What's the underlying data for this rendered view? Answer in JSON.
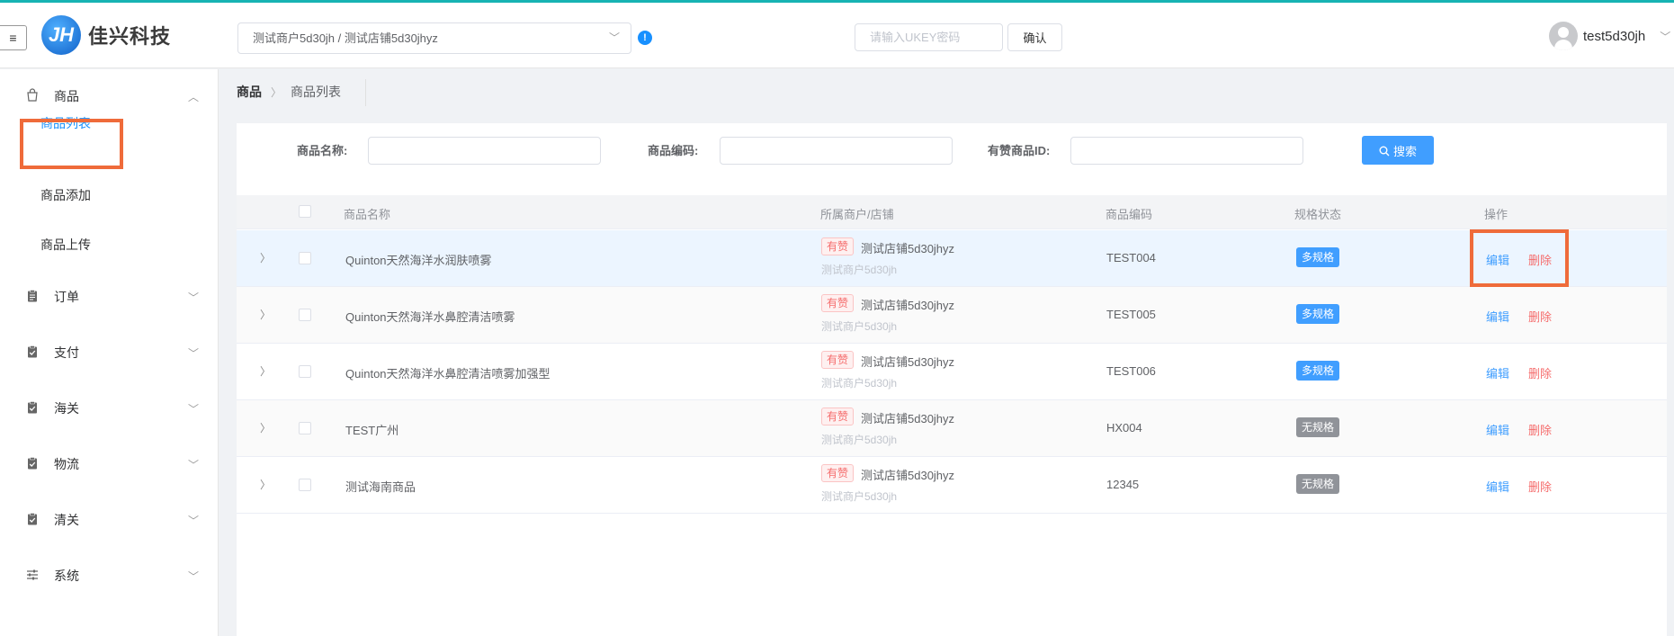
{
  "header": {
    "menu_toggle_icon": "≡",
    "logo_mark": "JH",
    "logo_text": "佳兴科技",
    "merchant_select_value": "测试商户5d30jh / 测试店铺5d30jhyz",
    "info_icon": "!",
    "ukey_placeholder": "请输入UKEY密码",
    "confirm_label": "确认",
    "username": "test5d30jh"
  },
  "sidebar": {
    "goods": {
      "label": "商品",
      "icon": "bag-icon"
    },
    "sub_items": [
      {
        "label": "商品列表",
        "active": true
      },
      {
        "label": "商品添加"
      },
      {
        "label": "商品上传"
      }
    ],
    "items": [
      {
        "label": "订单",
        "icon": "clipboard-icon"
      },
      {
        "label": "支付",
        "icon": "clipboard-check-icon"
      },
      {
        "label": "海关",
        "icon": "clipboard-check-icon"
      },
      {
        "label": "物流",
        "icon": "clipboard-check-icon"
      },
      {
        "label": "清关",
        "icon": "clipboard-check-icon"
      },
      {
        "label": "系统",
        "icon": "sliders-icon"
      }
    ]
  },
  "breadcrumb": {
    "level1": "商品",
    "level2": "商品列表"
  },
  "search": {
    "name_label": "商品名称:",
    "code_label": "商品编码:",
    "youzan_id_label": "有赞商品ID:",
    "button_label": "搜索"
  },
  "table": {
    "headers": {
      "name": "商品名称",
      "shop": "所属商户/店铺",
      "code": "商品编码",
      "spec": "规格状态",
      "ops": "操作"
    },
    "rows": [
      {
        "name": "Quinton天然海洋水润肤喷雾",
        "tag": "有赞",
        "shop": "测试店铺5d30jhyz",
        "merchant": "测试商户5d30jh",
        "code": "TEST004",
        "spec": "多规格",
        "edit": "编辑",
        "delete": "删除"
      },
      {
        "name": "Quinton天然海洋水鼻腔清洁喷雾",
        "tag": "有赞",
        "shop": "测试店铺5d30jhyz",
        "merchant": "测试商户5d30jh",
        "code": "TEST005",
        "spec": "多规格",
        "edit": "编辑",
        "delete": "删除"
      },
      {
        "name": "Quinton天然海洋水鼻腔清洁喷雾加强型",
        "tag": "有赞",
        "shop": "测试店铺5d30jhyz",
        "merchant": "测试商户5d30jh",
        "code": "TEST006",
        "spec": "多规格",
        "edit": "编辑",
        "delete": "删除"
      },
      {
        "name": "TEST广州",
        "tag": "有赞",
        "shop": "测试店铺5d30jhyz",
        "merchant": "测试商户5d30jh",
        "code": "HX004",
        "spec": "无规格",
        "edit": "编辑",
        "delete": "删除"
      },
      {
        "name": "测试海南商品",
        "tag": "有赞",
        "shop": "测试店铺5d30jhyz",
        "merchant": "测试商户5d30jh",
        "code": "12345",
        "spec": "无规格",
        "edit": "编辑",
        "delete": "删除"
      }
    ]
  },
  "colors": {
    "primary": "#409eff",
    "danger": "#f56c6c",
    "highlight": "#ef6b3a",
    "top_line": "#17b3b3"
  }
}
